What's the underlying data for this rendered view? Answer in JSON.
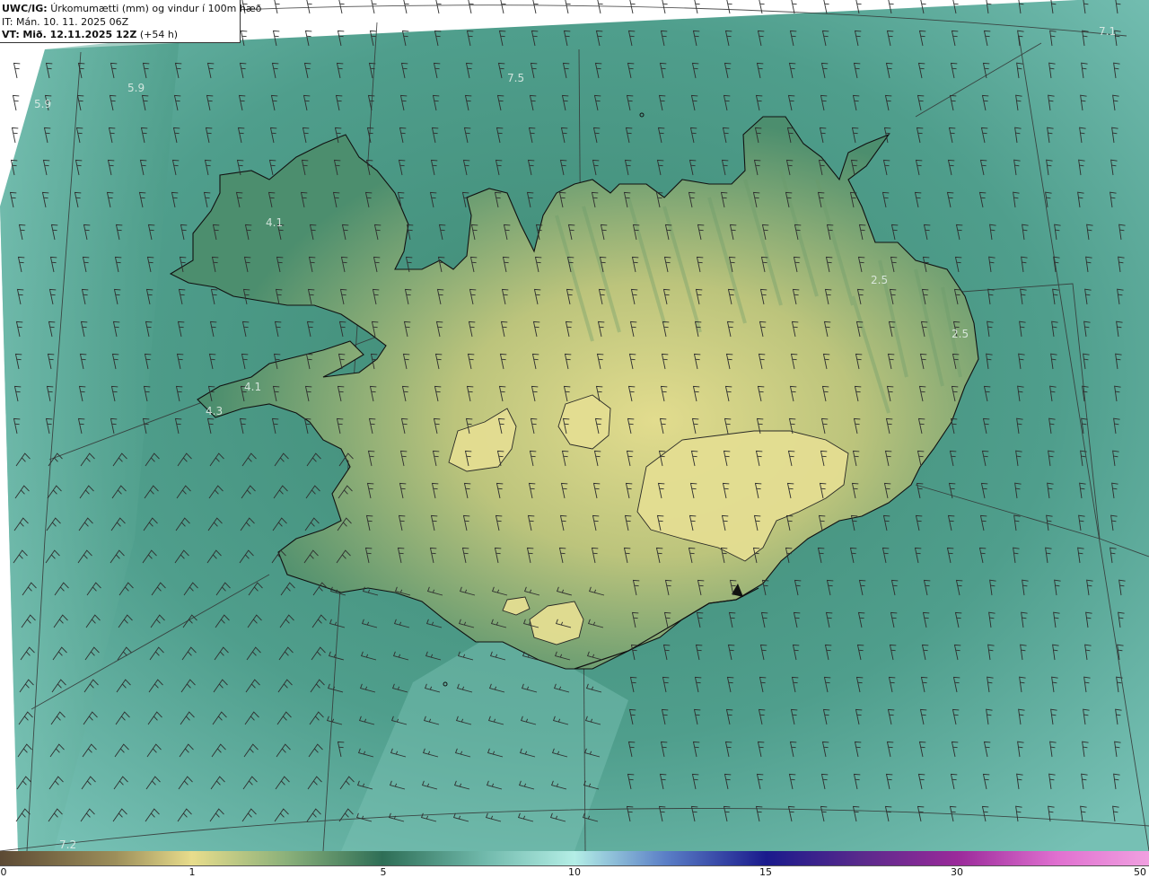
{
  "title": {
    "prefix": "UWC/IG:",
    "text": "Úrkomumætti (mm) og vindur í 100m hæð",
    "issue_prefix": "IT:",
    "issue": "Mán. 10. 11. 2025 06Z",
    "valid_prefix": "VT:",
    "valid": "Mið. 12.11.2025 12Z",
    "lead": "(+54 h)"
  },
  "value_labels": [
    "7.1",
    "7.5",
    "5.9",
    "5.9",
    "4.1",
    "4.3",
    "4.1",
    "2.5",
    "2.5",
    "7.2"
  ],
  "colorbar": {
    "ticks": [
      "0",
      "1",
      "5",
      "10",
      "15",
      "30",
      "50"
    ],
    "colors": [
      "#5c4a34",
      "#9c8e5a",
      "#e8dd8c",
      "#2e6e56",
      "#b4eee6",
      "#1a1a8c",
      "#9a2a9a",
      "#f0a0e0"
    ]
  },
  "map": {
    "land_color": "#d6d27e",
    "sea_color": "#5aa898",
    "coast_color": "#111111",
    "barb_color": "#333333"
  }
}
